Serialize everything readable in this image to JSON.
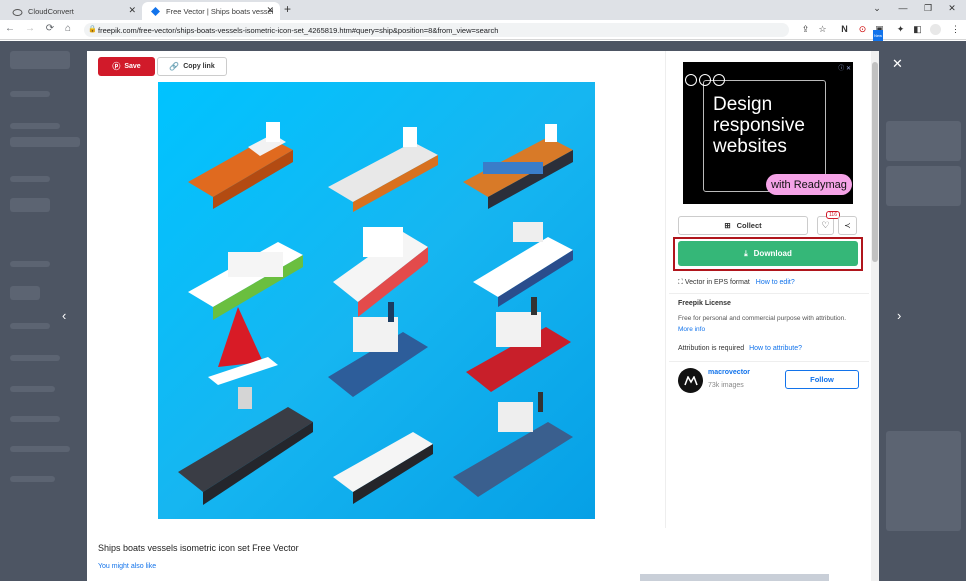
{
  "browser": {
    "tabs": [
      {
        "title": "CloudConvert"
      },
      {
        "title": "Free Vector | Ships boats vessel"
      }
    ],
    "new_tab": "+",
    "url": "freepik.com/free-vector/ships-boats-vessels-isometric-icon-set_4265819.htm#query=ship&position=8&from_view=search",
    "new_badge": "New"
  },
  "modal": {
    "save_label": "Save",
    "copy_link_label": "Copy link",
    "ad": {
      "headline": "Design responsive websites",
      "cta": "with Readymag"
    },
    "collect_label": "Collect",
    "like_count": "116",
    "download_label": "Download",
    "format_text": "Vector in EPS format",
    "how_to_edit": "How to edit?",
    "license_title": "Freepik License",
    "license_text": "Free for personal and commercial purpose with attribution.",
    "more_info": "More info",
    "attribution_text": "Attribution is required",
    "how_to_attribute": "How to attribute?",
    "author_name": "macrovector",
    "author_images": "73k images",
    "follow_label": "Follow",
    "caption": "Ships boats vessels isometric icon set Free Vector",
    "also_like": "You might also like"
  },
  "colors": {
    "save": "#d11a2a",
    "download": "#35b778",
    "download_outline": "#b0151c",
    "link": "#1273eb",
    "art_bg": "#16b6f1"
  }
}
